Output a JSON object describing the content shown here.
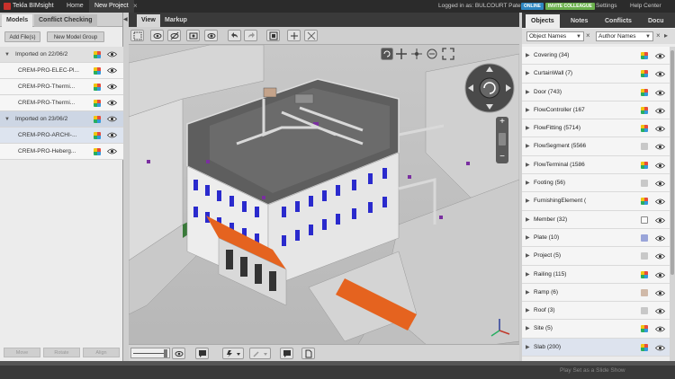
{
  "titlebar": {
    "app_name": "Tekla BIMsight",
    "tabs": [
      "Home",
      "New Project"
    ],
    "login_text": "Logged in as: BULCOURT Paterne",
    "online_badge": "ONLINE",
    "invite_badge": "INVITE COLLEAGUE",
    "settings": "Settings",
    "help": "Help Center",
    "close_glyph": "×"
  },
  "left": {
    "tabs": [
      "Models",
      "Conflict Checking"
    ],
    "add_files": "Add File(s)",
    "new_group": "New Model Group",
    "groups": [
      {
        "label": "Imported on 22/06/2",
        "items": [
          "CREM-PRO-ELEC-Pl...",
          "CREM-PRO-Thermi...",
          "CREM-PRO-Thermi..."
        ]
      },
      {
        "label": "Imported on 23/06/2",
        "items": [
          "CREM-PRO-ARCHI-...",
          "CREM-PRO-Heberg..."
        ]
      }
    ],
    "bottom_buttons": [
      "Move",
      "Rotate",
      "Align"
    ]
  },
  "center": {
    "tabs": [
      "View",
      "Markup"
    ]
  },
  "right": {
    "tabs": [
      "Objects",
      "Notes",
      "Conflicts",
      "Docu"
    ],
    "filter1": "Object Names",
    "filter2": "Author Names",
    "objects": [
      {
        "label": "Covering (34)",
        "swatch": "multi"
      },
      {
        "label": "CurtainWall (7)",
        "swatch": "multi"
      },
      {
        "label": "Door (743)",
        "swatch": "multi"
      },
      {
        "label": "FlowController (167",
        "swatch": "multi"
      },
      {
        "label": "FlowFitting (5714)",
        "swatch": "multi"
      },
      {
        "label": "FlowSegment (5566",
        "swatch": "gray"
      },
      {
        "label": "FlowTerminal (1586",
        "swatch": "multi"
      },
      {
        "label": "Footing (56)",
        "swatch": "gray"
      },
      {
        "label": "FurnishingElement (",
        "swatch": "multi"
      },
      {
        "label": "Member (32)",
        "swatch": "white"
      },
      {
        "label": "Plate (10)",
        "swatch": "blue"
      },
      {
        "label": "Project (5)",
        "swatch": "plain"
      },
      {
        "label": "Railing (115)",
        "swatch": "multi"
      },
      {
        "label": "Ramp (6)",
        "swatch": "tan"
      },
      {
        "label": "Roof (3)",
        "swatch": "plain"
      },
      {
        "label": "Site (5)",
        "swatch": "multi"
      },
      {
        "label": "Slab (200)",
        "swatch": "multi"
      }
    ]
  },
  "status": {
    "slideshow": "Play Set as a Slide Show"
  }
}
